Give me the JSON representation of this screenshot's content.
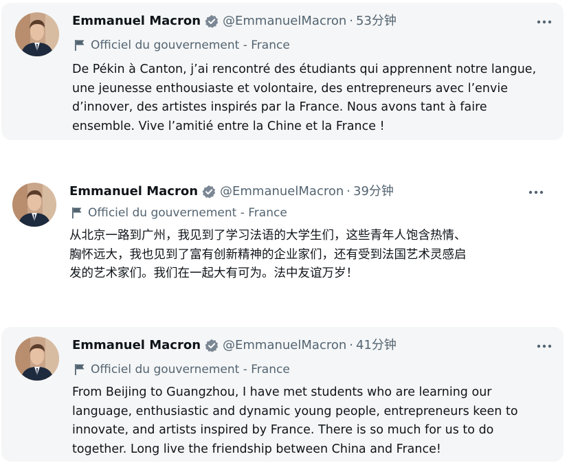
{
  "colors": {
    "card_background": "#f5f6f7",
    "text_primary": "#0f1419",
    "text_secondary": "#536471",
    "verified_badge": "#7b8794"
  },
  "tweets": [
    {
      "author": {
        "name": "Emmanuel Macron",
        "handle": "@EmmanuelMacron",
        "verified_icon": "verified-badge-icon"
      },
      "separator": "·",
      "time": "53分钟",
      "label": "Officiel du gouvernement - France",
      "label_icon": "flag-icon",
      "more_icon": "more-options-icon",
      "lines": [
        "De Pékin à Canton, j’ai rencontré des étudiants qui apprennent notre langue,",
        "une jeunesse enthousiaste et volontaire, des entrepreneurs avec l’envie",
        "d’innover, des artistes inspirés par la France. Nous avons tant à faire",
        "ensemble. Vive l’amitié entre la Chine et la France !"
      ]
    },
    {
      "author": {
        "name": "Emmanuel Macron",
        "handle": "@EmmanuelMacron",
        "verified_icon": "verified-badge-icon"
      },
      "separator": "·",
      "time": "39分钟",
      "label": "Officiel du gouvernement - France",
      "label_icon": "flag-icon",
      "more_icon": "more-options-icon",
      "lines": [
        "从北京一路到广州，我见到了学习法语的大学生们，这些青年人饱含热情、",
        "胸怀远大，我也见到了富有创新精神的企业家们，还有受到法国艺术灵感启",
        "发的艺术家们。我们在一起大有可为。法中友谊万岁！"
      ]
    },
    {
      "author": {
        "name": "Emmanuel Macron",
        "handle": "@EmmanuelMacron",
        "verified_icon": "verified-badge-icon"
      },
      "separator": "·",
      "time": "41分钟",
      "label": "Officiel du gouvernement - France",
      "label_icon": "flag-icon",
      "more_icon": "more-options-icon",
      "lines": [
        "From Beijing to Guangzhou, I have met students who are learning our",
        "language, enthusiastic and dynamic young people, entrepreneurs keen to",
        "innovate, and artists inspired by France. There is so much for us to do",
        "together. Long live the friendship between China and France!"
      ]
    }
  ]
}
